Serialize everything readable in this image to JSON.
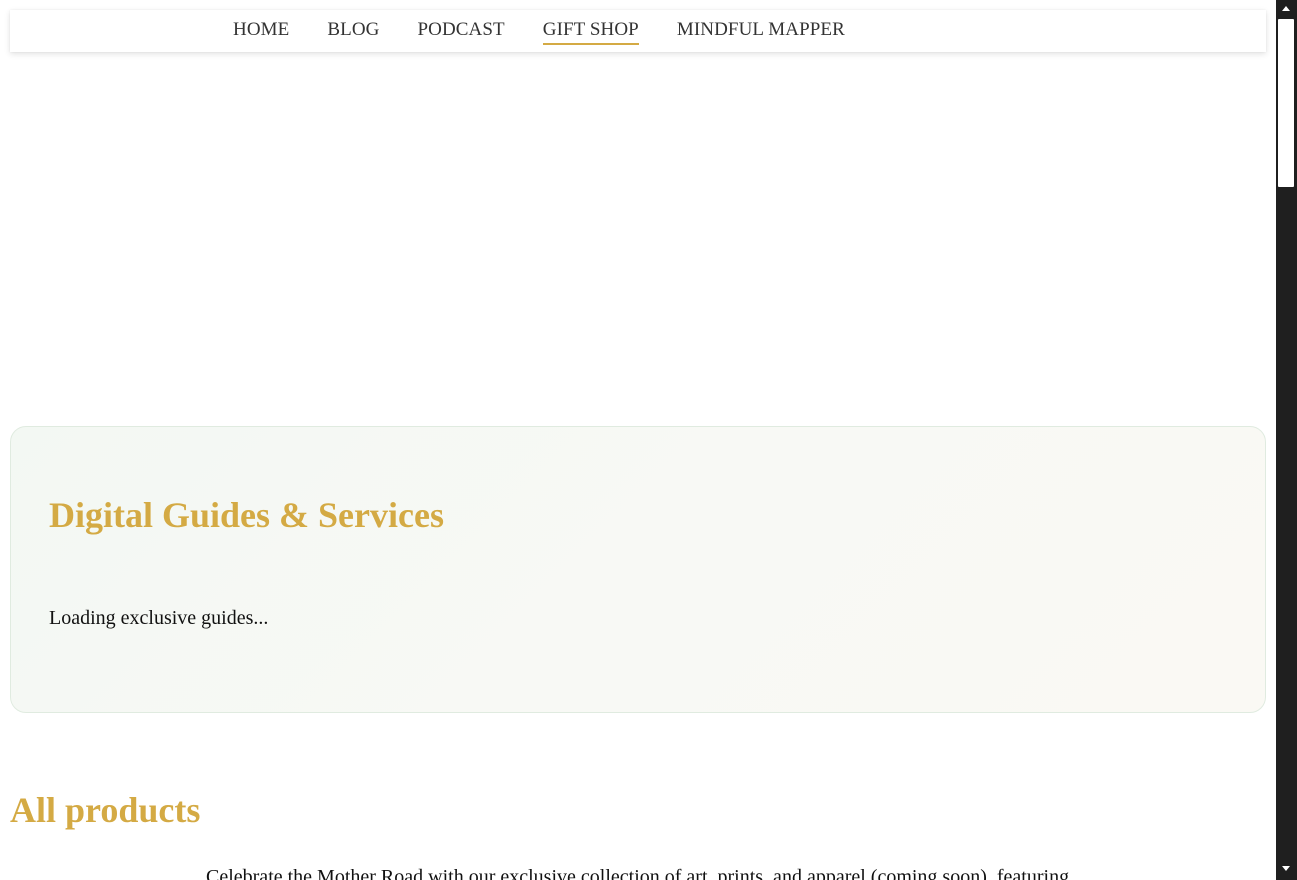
{
  "nav": {
    "items": [
      {
        "label": "HOME",
        "active": false
      },
      {
        "label": "BLOG",
        "active": false
      },
      {
        "label": "PODCAST",
        "active": false
      },
      {
        "label": "GIFT SHOP",
        "active": true
      },
      {
        "label": "MINDFUL MAPPER",
        "active": false
      }
    ]
  },
  "guides": {
    "title": "Digital Guides & Services",
    "loading_text": "Loading exclusive guides..."
  },
  "products": {
    "title": "All products",
    "description": "Celebrate the Mother Road with our exclusive collection of art, prints, and apparel (coming soon), featuring"
  },
  "colors": {
    "accent": "#d4aa44",
    "text": "#111111",
    "nav_text": "#333333",
    "scrollbar_track": "#1f1f1f",
    "scrollbar_thumb": "#ffffff"
  },
  "icons": {
    "scroll_up": "scroll-up-arrow-icon",
    "scroll_down": "scroll-down-arrow-icon"
  }
}
